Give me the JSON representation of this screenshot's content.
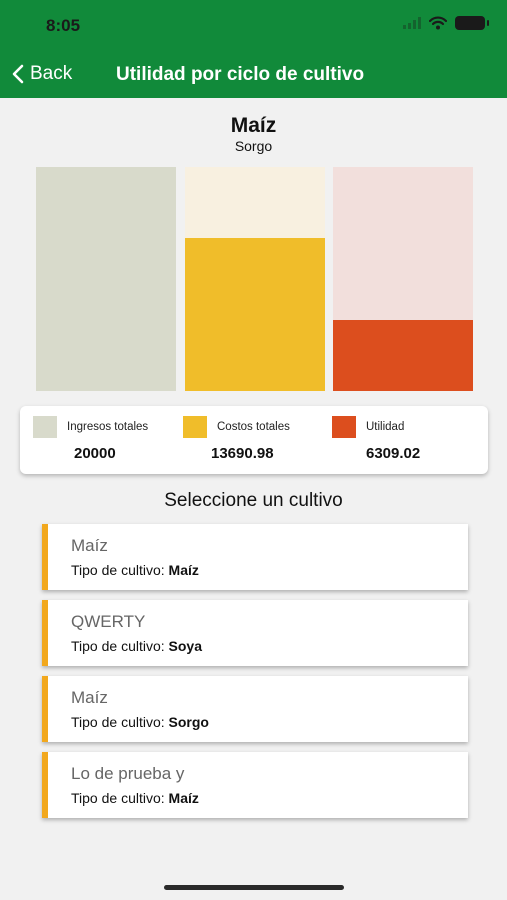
{
  "status_bar": {
    "time": "8:05"
  },
  "nav": {
    "back_label": "Back",
    "title": "Utilidad por ciclo de cultivo"
  },
  "chart_data": {
    "type": "bar",
    "title": "Maíz",
    "subtitle": "Sorgo",
    "categories": [
      "Ingresos totales",
      "Costos totales",
      "Utilidad"
    ],
    "values": [
      20000,
      13690.98,
      6309.02
    ],
    "value_labels": [
      "20000",
      "13690.98",
      "6309.02"
    ],
    "ylim": [
      0,
      20000
    ],
    "colors": [
      "#d8dacb",
      "#f0bd2a",
      "#dc4e1e"
    ],
    "bg_colors": [
      "#dadbce",
      "#f8f0e0",
      "#f2dfdc"
    ],
    "legend_position": "bottom",
    "grid": false
  },
  "section_title": "Seleccione un cultivo",
  "crop_list": {
    "type_prefix": "Tipo de cultivo: ",
    "items": [
      {
        "name": "Maíz",
        "type": "Maíz"
      },
      {
        "name": "QWERTY",
        "type": "Soya"
      },
      {
        "name": "Maíz",
        "type": "Sorgo"
      },
      {
        "name": "Lo de prueba y",
        "type": "Maíz"
      }
    ]
  },
  "colors": {
    "header": "#118a3a",
    "accent": "#f2a81d"
  }
}
